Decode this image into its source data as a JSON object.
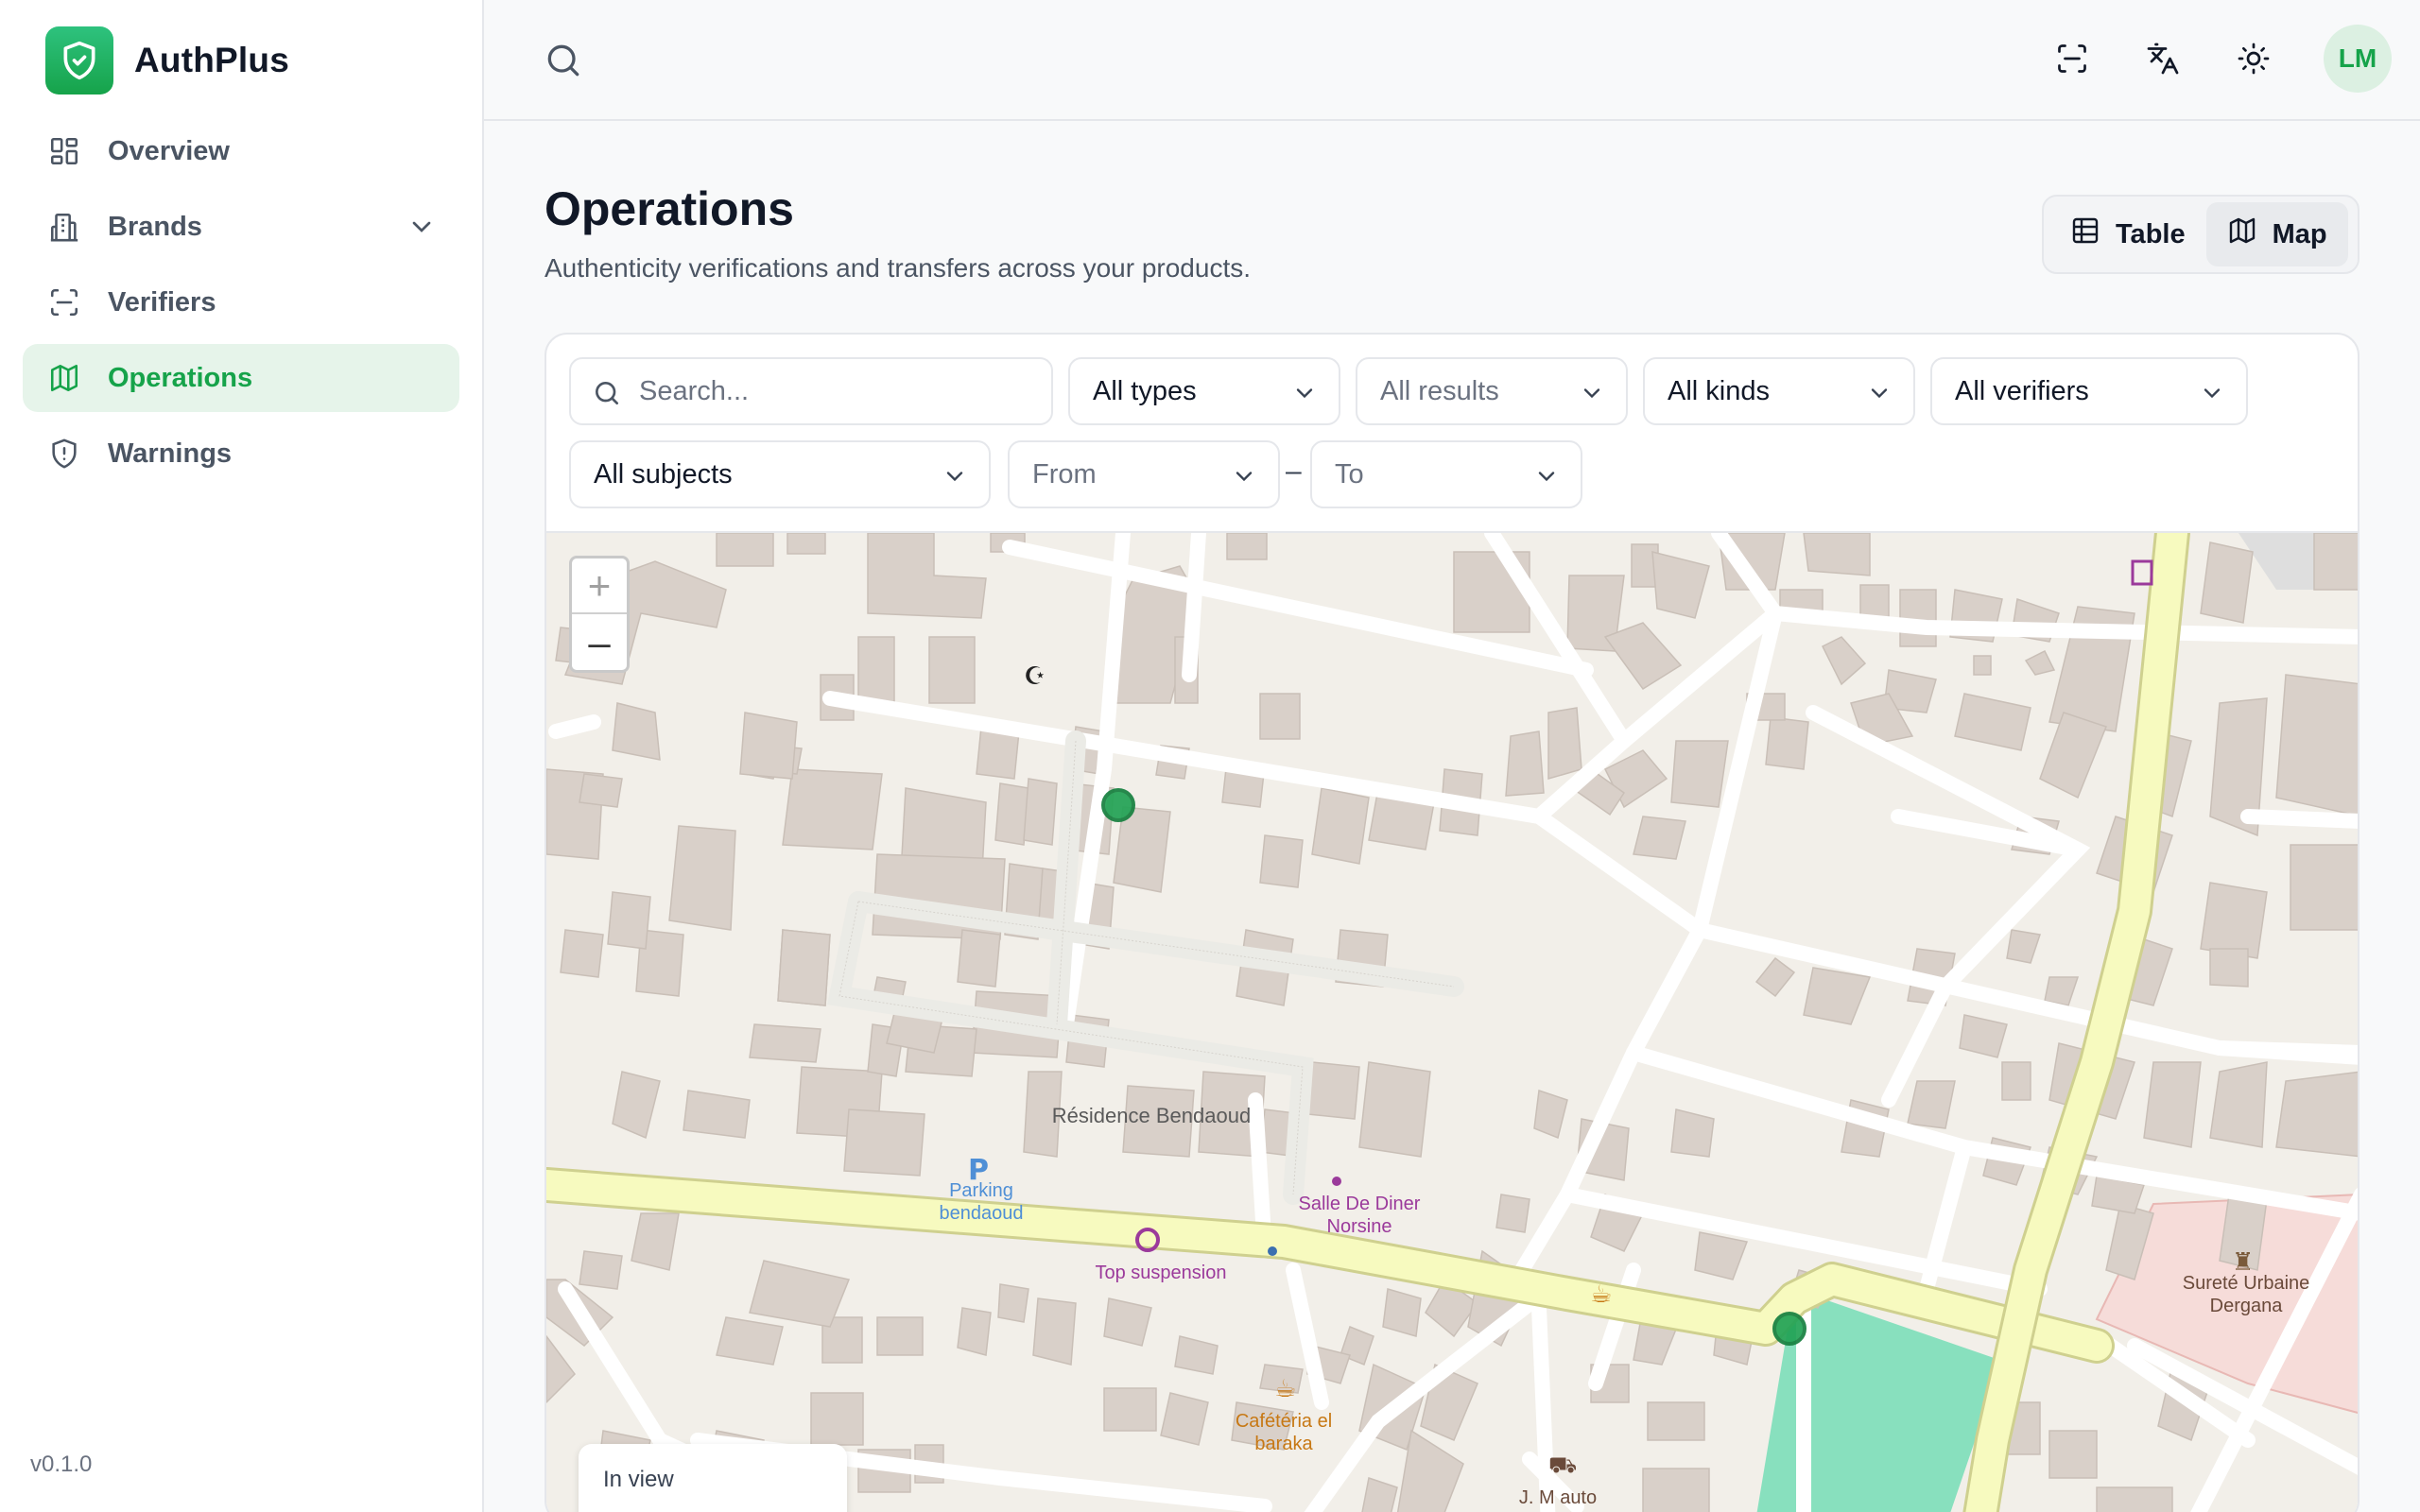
{
  "app": {
    "name": "AuthPlus",
    "version": "v0.1.0"
  },
  "sidebar": {
    "items": [
      {
        "label": "Overview",
        "icon": "grid-icon",
        "active": false
      },
      {
        "label": "Brands",
        "icon": "building-icon",
        "active": false,
        "expandable": true
      },
      {
        "label": "Verifiers",
        "icon": "scan-icon",
        "active": false
      },
      {
        "label": "Operations",
        "icon": "map-icon",
        "active": true
      },
      {
        "label": "Warnings",
        "icon": "shield-alert-icon",
        "active": false
      }
    ]
  },
  "topbar": {
    "search_icon": "search-icon",
    "actions": [
      "scan-icon",
      "translate-icon",
      "sun-icon"
    ],
    "avatar_initials": "LM"
  },
  "page": {
    "title": "Operations",
    "subtitle": "Authenticity verifications and transfers across your products."
  },
  "view_toggle": {
    "options": [
      {
        "label": "Table",
        "icon": "table-icon",
        "active": false
      },
      {
        "label": "Map",
        "icon": "map-icon",
        "active": true
      }
    ]
  },
  "filters": {
    "search_placeholder": "Search...",
    "types": "All types",
    "results": "All results",
    "kinds": "All kinds",
    "verifiers": "All verifiers",
    "subjects": "All subjects",
    "from": "From",
    "range_separator": "–",
    "to": "To"
  },
  "map": {
    "zoom_in": "+",
    "zoom_out": "–",
    "labels": {
      "residence": "Résidence Bendaoud",
      "parking": "Parking bendaoud",
      "salle": "Salle De Diner Norsine",
      "top_suspension": "Top suspension",
      "cafeteria": "Cafétéria el baraka",
      "surete": "Sureté Urbaine Dergana",
      "m_auto": "J. M auto"
    },
    "markers_count": 2,
    "in_view_label": "In view"
  },
  "colors": {
    "accent": "#16a34a",
    "accent_light": "#e6f4ea",
    "map_land": "#f2efe9",
    "map_building": "#d9d0c9",
    "map_primary_road": "#f7fabf",
    "map_park": "#88e0be",
    "marker": "#22a355"
  }
}
